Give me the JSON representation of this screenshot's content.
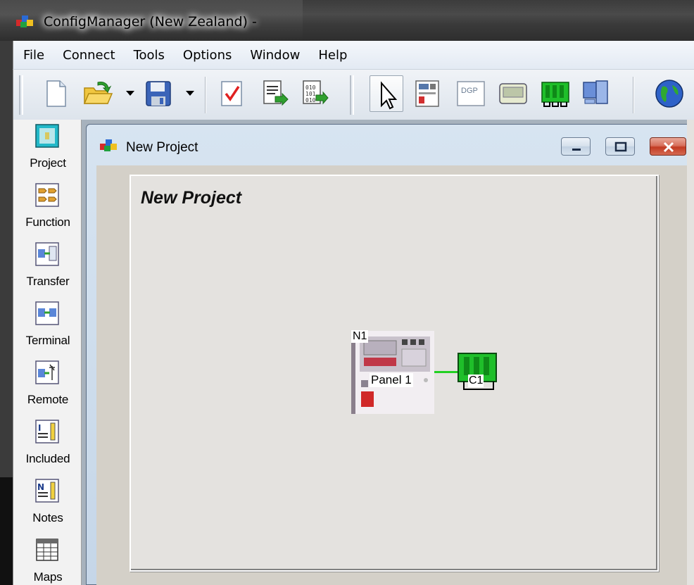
{
  "app": {
    "title": "ConfigManager (New Zealand) -"
  },
  "menu": [
    "File",
    "Connect",
    "Tools",
    "Options",
    "Window",
    "Help"
  ],
  "toolbar": {
    "buttons": [
      "new-file",
      "open-folder",
      "save",
      "check-document",
      "document-import",
      "binary-export",
      "pointer",
      "panel-layout",
      "dgp",
      "enclosure",
      "loop-card",
      "network-computer",
      "globe"
    ],
    "dgp_label": "DGP"
  },
  "sidebar": [
    {
      "label": "Project",
      "icon": "project-icon"
    },
    {
      "label": "Function",
      "icon": "function-icon"
    },
    {
      "label": "Transfer",
      "icon": "transfer-icon"
    },
    {
      "label": "Terminal",
      "icon": "terminal-icon"
    },
    {
      "label": "Remote",
      "icon": "remote-icon"
    },
    {
      "label": "Included",
      "icon": "included-icon"
    },
    {
      "label": "Notes",
      "icon": "notes-icon"
    },
    {
      "label": "Maps",
      "icon": "maps-icon"
    }
  ],
  "window": {
    "title": "New Project",
    "heading": "New Project"
  },
  "diagram": {
    "panel": {
      "id": "N1",
      "label": "Panel 1"
    },
    "card": {
      "label": "C1"
    }
  },
  "colors": {
    "link": "#22d022",
    "card_green": "#1fbf2a",
    "close_red": "#c23b22"
  }
}
